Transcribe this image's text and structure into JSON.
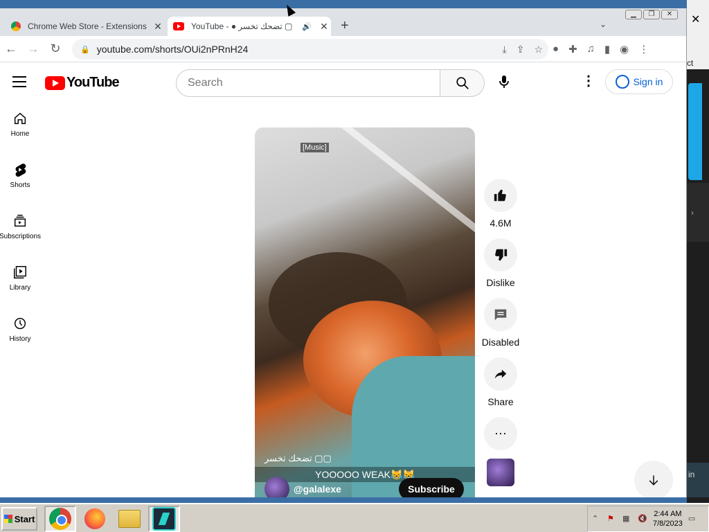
{
  "browser": {
    "tabs": [
      {
        "title": "Chrome Web Store - Extensions",
        "active": false
      },
      {
        "title": "YouTube - ● تضحك تخسر ▢",
        "active": true
      }
    ],
    "url": "youtube.com/shorts/OUi2nPRnH24"
  },
  "youtube": {
    "logo_text": "YouTube",
    "search_placeholder": "Search",
    "signin_label": "Sign in",
    "sidebar": [
      {
        "label": "Home",
        "icon": "home-icon"
      },
      {
        "label": "Shorts",
        "icon": "shorts-icon"
      },
      {
        "label": "Subscriptions",
        "icon": "subscriptions-icon"
      },
      {
        "label": "Library",
        "icon": "library-icon"
      },
      {
        "label": "History",
        "icon": "history-icon"
      }
    ],
    "video": {
      "music_caption": "[Music]",
      "title_overlay": "تضحك تخسر ▢▢",
      "caption": "YOOOOO WEAK😹😹",
      "channel": "@galalexe",
      "subscribe_label": "Subscribe"
    },
    "actions": {
      "like_count": "4.6M",
      "dislike_label": "Dislike",
      "comments_label": "Disabled",
      "share_label": "Share"
    }
  },
  "taskbar": {
    "start_label": "Start",
    "time": "2:44 AM",
    "date": "7/8/2023"
  },
  "desktop": {
    "right_text_top": "ct",
    "right_text_bottom": "in"
  }
}
